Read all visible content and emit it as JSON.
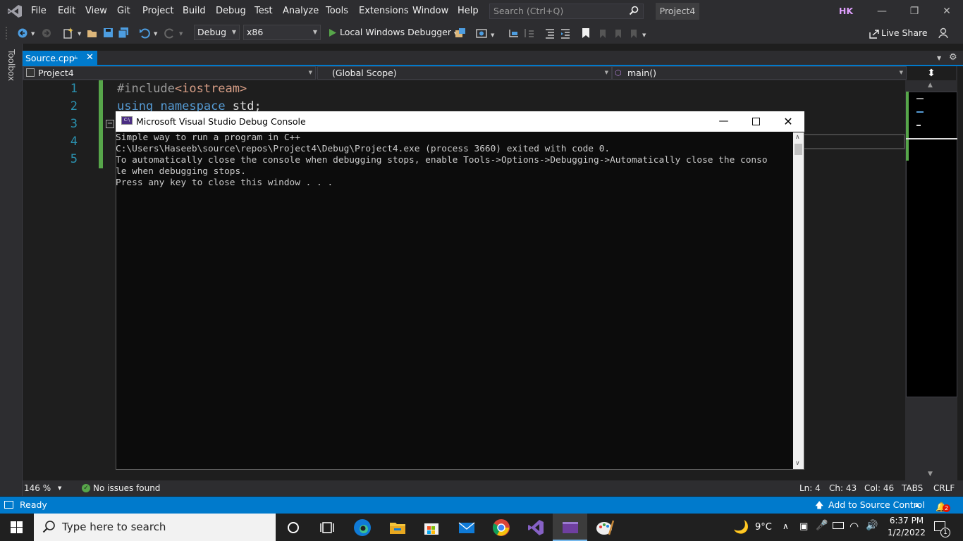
{
  "menu": {
    "items": [
      "File",
      "Edit",
      "View",
      "Git",
      "Project",
      "Build",
      "Debug",
      "Test",
      "Analyze",
      "Tools",
      "Extensions",
      "Window",
      "Help"
    ],
    "search_placeholder": "Search (Ctrl+Q)",
    "project_name": "Project4",
    "user_initials": "HK"
  },
  "toolbar": {
    "config": "Debug",
    "platform": "x86",
    "debugger": "Local Windows Debugger",
    "live_share": "Live Share"
  },
  "toolbox": {
    "label": "Toolbox"
  },
  "tab": {
    "name": "Source.cpp"
  },
  "nav": {
    "project": "Project4",
    "scope": "(Global Scope)",
    "member": "main()"
  },
  "editor": {
    "lines": [
      {
        "num": "1",
        "parts": [
          {
            "t": "#include",
            "c": "#9b9b9b"
          },
          {
            "t": "<iostream>",
            "c": "#d69d85"
          }
        ]
      },
      {
        "num": "2",
        "parts": [
          {
            "t": "using",
            "c": "#569cd6"
          },
          {
            "t": " ",
            "c": "#dcdcdc"
          },
          {
            "t": "namespace",
            "c": "#569cd6"
          },
          {
            "t": " std;",
            "c": "#dcdcdc"
          }
        ]
      },
      {
        "num": "3",
        "parts": []
      },
      {
        "num": "4",
        "parts": []
      },
      {
        "num": "5",
        "parts": []
      }
    ]
  },
  "editor_status": {
    "zoom": "146 %",
    "issues": "No issues found",
    "line": "Ln: 4",
    "char": "Ch: 43",
    "col": "Col: 46",
    "tabs": "TABS",
    "eol": "CRLF"
  },
  "statusbar": {
    "state": "Ready",
    "source_control": "Add to Source Control",
    "notifications": "2"
  },
  "console": {
    "title": "Microsoft Visual Studio Debug Console",
    "lines": [
      "Simple way to run a program in C++",
      "C:\\Users\\Haseeb\\source\\repos\\Project4\\Debug\\Project4.exe (process 3660) exited with code 0.",
      "To automatically close the console when debugging stops, enable Tools->Options->Debugging->Automatically close the conso",
      "le when debugging stops.",
      "Press any key to close this window . . ."
    ]
  },
  "taskbar": {
    "search_placeholder": "Type here to search",
    "weather": "9°C",
    "time": "6:37 PM",
    "date": "1/2/2022",
    "notification_count": "1"
  }
}
